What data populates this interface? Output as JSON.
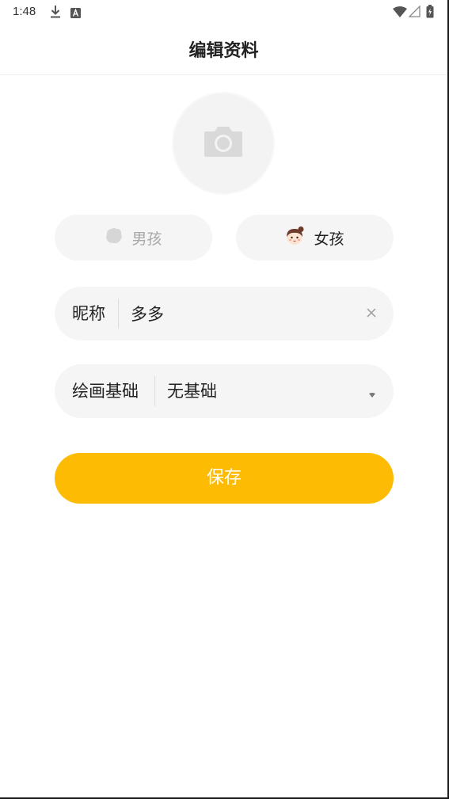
{
  "status_bar": {
    "time": "1:48",
    "icons": [
      "download-icon",
      "a-notification-icon",
      "wifi-icon",
      "signal-icon",
      "battery-charging-icon"
    ]
  },
  "header": {
    "title": "编辑资料"
  },
  "avatar": {
    "icon": "camera-icon"
  },
  "gender": {
    "boy_label": "男孩",
    "girl_label": "女孩",
    "selected": "girl"
  },
  "nickname": {
    "label": "昵称",
    "value": "多多",
    "clear_icon": "close-icon"
  },
  "drawing_level": {
    "label": "绘画基础",
    "value": "无基础",
    "dropdown_icon": "caret-down-icon"
  },
  "actions": {
    "save_label": "保存"
  },
  "colors": {
    "accent": "#fdbb04",
    "field_background": "#f5f5f5",
    "disabled_text": "#a8a8a8"
  }
}
